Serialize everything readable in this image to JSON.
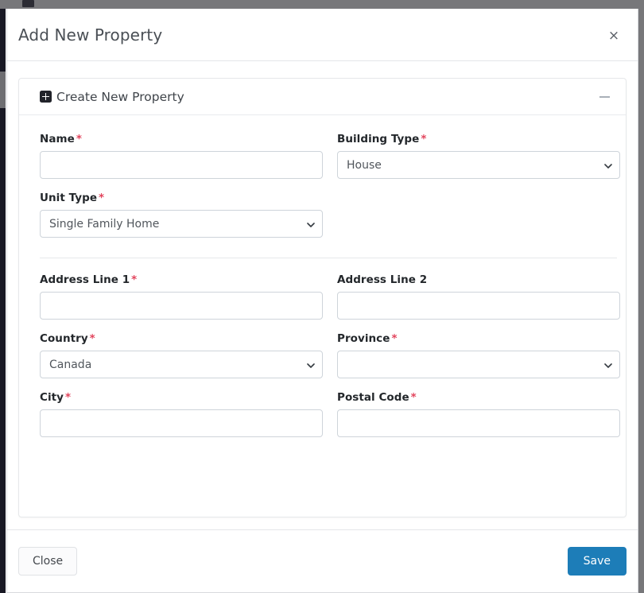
{
  "background": {
    "hamburger_icon": "hamburger-menu-icon"
  },
  "modal": {
    "title": "Add New Property",
    "close_icon": "×",
    "card": {
      "title": "Create New Property",
      "expand_icon": "plus-square-icon",
      "collapse_icon": "minus-icon"
    },
    "footer": {
      "close_label": "Close",
      "save_label": "Save"
    }
  },
  "form": {
    "required_marker": "*",
    "fields": {
      "name": {
        "label": "Name",
        "required": true,
        "type": "text",
        "value": "",
        "placeholder": ""
      },
      "building_type": {
        "label": "Building Type",
        "required": true,
        "type": "select",
        "value": "House",
        "options": [
          "House"
        ]
      },
      "unit_type": {
        "label": "Unit Type",
        "required": true,
        "type": "select",
        "value": "Single Family Home",
        "options": [
          "Single Family Home"
        ]
      },
      "address_line_1": {
        "label": "Address Line 1",
        "required": true,
        "type": "text",
        "value": "",
        "placeholder": ""
      },
      "address_line_2": {
        "label": "Address Line 2",
        "required": false,
        "type": "text",
        "value": "",
        "placeholder": ""
      },
      "country": {
        "label": "Country",
        "required": true,
        "type": "select",
        "value": "Canada",
        "options": [
          "Canada"
        ]
      },
      "province": {
        "label": "Province",
        "required": true,
        "type": "select",
        "value": "",
        "options": []
      },
      "city": {
        "label": "City",
        "required": true,
        "type": "text",
        "value": "",
        "placeholder": ""
      },
      "postal_code": {
        "label": "Postal Code",
        "required": true,
        "type": "text",
        "value": "",
        "placeholder": ""
      }
    }
  },
  "colors": {
    "accent_blue": "#1d7db8",
    "required_red": "#e2445c",
    "border_gray": "#ced4da",
    "text_dark": "#23272b"
  }
}
